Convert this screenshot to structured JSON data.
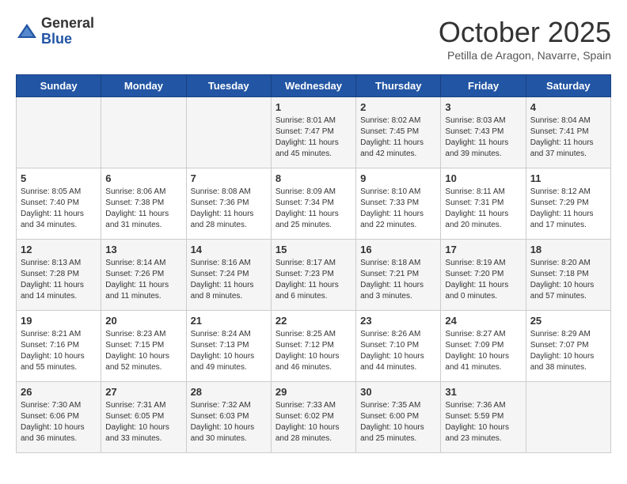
{
  "logo": {
    "general": "General",
    "blue": "Blue"
  },
  "title": "October 2025",
  "location": "Petilla de Aragon, Navarre, Spain",
  "days_header": [
    "Sunday",
    "Monday",
    "Tuesday",
    "Wednesday",
    "Thursday",
    "Friday",
    "Saturday"
  ],
  "weeks": [
    [
      {
        "day": "",
        "text": ""
      },
      {
        "day": "",
        "text": ""
      },
      {
        "day": "",
        "text": ""
      },
      {
        "day": "1",
        "text": "Sunrise: 8:01 AM\nSunset: 7:47 PM\nDaylight: 11 hours and 45 minutes."
      },
      {
        "day": "2",
        "text": "Sunrise: 8:02 AM\nSunset: 7:45 PM\nDaylight: 11 hours and 42 minutes."
      },
      {
        "day": "3",
        "text": "Sunrise: 8:03 AM\nSunset: 7:43 PM\nDaylight: 11 hours and 39 minutes."
      },
      {
        "day": "4",
        "text": "Sunrise: 8:04 AM\nSunset: 7:41 PM\nDaylight: 11 hours and 37 minutes."
      }
    ],
    [
      {
        "day": "5",
        "text": "Sunrise: 8:05 AM\nSunset: 7:40 PM\nDaylight: 11 hours and 34 minutes."
      },
      {
        "day": "6",
        "text": "Sunrise: 8:06 AM\nSunset: 7:38 PM\nDaylight: 11 hours and 31 minutes."
      },
      {
        "day": "7",
        "text": "Sunrise: 8:08 AM\nSunset: 7:36 PM\nDaylight: 11 hours and 28 minutes."
      },
      {
        "day": "8",
        "text": "Sunrise: 8:09 AM\nSunset: 7:34 PM\nDaylight: 11 hours and 25 minutes."
      },
      {
        "day": "9",
        "text": "Sunrise: 8:10 AM\nSunset: 7:33 PM\nDaylight: 11 hours and 22 minutes."
      },
      {
        "day": "10",
        "text": "Sunrise: 8:11 AM\nSunset: 7:31 PM\nDaylight: 11 hours and 20 minutes."
      },
      {
        "day": "11",
        "text": "Sunrise: 8:12 AM\nSunset: 7:29 PM\nDaylight: 11 hours and 17 minutes."
      }
    ],
    [
      {
        "day": "12",
        "text": "Sunrise: 8:13 AM\nSunset: 7:28 PM\nDaylight: 11 hours and 14 minutes."
      },
      {
        "day": "13",
        "text": "Sunrise: 8:14 AM\nSunset: 7:26 PM\nDaylight: 11 hours and 11 minutes."
      },
      {
        "day": "14",
        "text": "Sunrise: 8:16 AM\nSunset: 7:24 PM\nDaylight: 11 hours and 8 minutes."
      },
      {
        "day": "15",
        "text": "Sunrise: 8:17 AM\nSunset: 7:23 PM\nDaylight: 11 hours and 6 minutes."
      },
      {
        "day": "16",
        "text": "Sunrise: 8:18 AM\nSunset: 7:21 PM\nDaylight: 11 hours and 3 minutes."
      },
      {
        "day": "17",
        "text": "Sunrise: 8:19 AM\nSunset: 7:20 PM\nDaylight: 11 hours and 0 minutes."
      },
      {
        "day": "18",
        "text": "Sunrise: 8:20 AM\nSunset: 7:18 PM\nDaylight: 10 hours and 57 minutes."
      }
    ],
    [
      {
        "day": "19",
        "text": "Sunrise: 8:21 AM\nSunset: 7:16 PM\nDaylight: 10 hours and 55 minutes."
      },
      {
        "day": "20",
        "text": "Sunrise: 8:23 AM\nSunset: 7:15 PM\nDaylight: 10 hours and 52 minutes."
      },
      {
        "day": "21",
        "text": "Sunrise: 8:24 AM\nSunset: 7:13 PM\nDaylight: 10 hours and 49 minutes."
      },
      {
        "day": "22",
        "text": "Sunrise: 8:25 AM\nSunset: 7:12 PM\nDaylight: 10 hours and 46 minutes."
      },
      {
        "day": "23",
        "text": "Sunrise: 8:26 AM\nSunset: 7:10 PM\nDaylight: 10 hours and 44 minutes."
      },
      {
        "day": "24",
        "text": "Sunrise: 8:27 AM\nSunset: 7:09 PM\nDaylight: 10 hours and 41 minutes."
      },
      {
        "day": "25",
        "text": "Sunrise: 8:29 AM\nSunset: 7:07 PM\nDaylight: 10 hours and 38 minutes."
      }
    ],
    [
      {
        "day": "26",
        "text": "Sunrise: 7:30 AM\nSunset: 6:06 PM\nDaylight: 10 hours and 36 minutes."
      },
      {
        "day": "27",
        "text": "Sunrise: 7:31 AM\nSunset: 6:05 PM\nDaylight: 10 hours and 33 minutes."
      },
      {
        "day": "28",
        "text": "Sunrise: 7:32 AM\nSunset: 6:03 PM\nDaylight: 10 hours and 30 minutes."
      },
      {
        "day": "29",
        "text": "Sunrise: 7:33 AM\nSunset: 6:02 PM\nDaylight: 10 hours and 28 minutes."
      },
      {
        "day": "30",
        "text": "Sunrise: 7:35 AM\nSunset: 6:00 PM\nDaylight: 10 hours and 25 minutes."
      },
      {
        "day": "31",
        "text": "Sunrise: 7:36 AM\nSunset: 5:59 PM\nDaylight: 10 hours and 23 minutes."
      },
      {
        "day": "",
        "text": ""
      }
    ]
  ]
}
